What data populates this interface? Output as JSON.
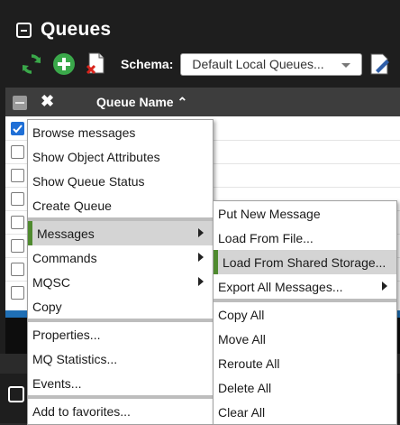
{
  "panel": {
    "title": "Queues",
    "schema_label": "Schema:",
    "schema_value": "Default Local Queues..."
  },
  "table": {
    "header_close": "✖",
    "header_column": "Queue Name ⌃"
  },
  "context_menu": {
    "items": [
      {
        "label": "Browse messages"
      },
      {
        "label": "Show Object Attributes"
      },
      {
        "label": "Show Queue Status"
      },
      {
        "label": "Create Queue"
      },
      {
        "label": "Messages",
        "submenu": true,
        "selected": true
      },
      {
        "label": "Commands",
        "submenu": true
      },
      {
        "label": "MQSC",
        "submenu": true
      },
      {
        "label": "Copy"
      },
      {
        "label": "Properties..."
      },
      {
        "label": "MQ Statistics..."
      },
      {
        "label": "Events..."
      },
      {
        "label": "Add to favorites..."
      }
    ]
  },
  "messages_submenu": {
    "items": [
      {
        "label": "Put New Message"
      },
      {
        "label": "Load From File..."
      },
      {
        "label": "Load From Shared Storage...",
        "selected": true
      },
      {
        "label": "Export All Messages...",
        "submenu": true
      },
      {
        "label": "Copy All"
      },
      {
        "label": "Move All"
      },
      {
        "label": "Reroute All"
      },
      {
        "label": "Delete All"
      },
      {
        "label": "Clear All"
      }
    ]
  },
  "colors": {
    "selected_accent": "#4f8a2f",
    "refresh_icon": "#3aa84a",
    "add_icon": "#3aa84a",
    "table_footer": "#1f6fb5"
  }
}
